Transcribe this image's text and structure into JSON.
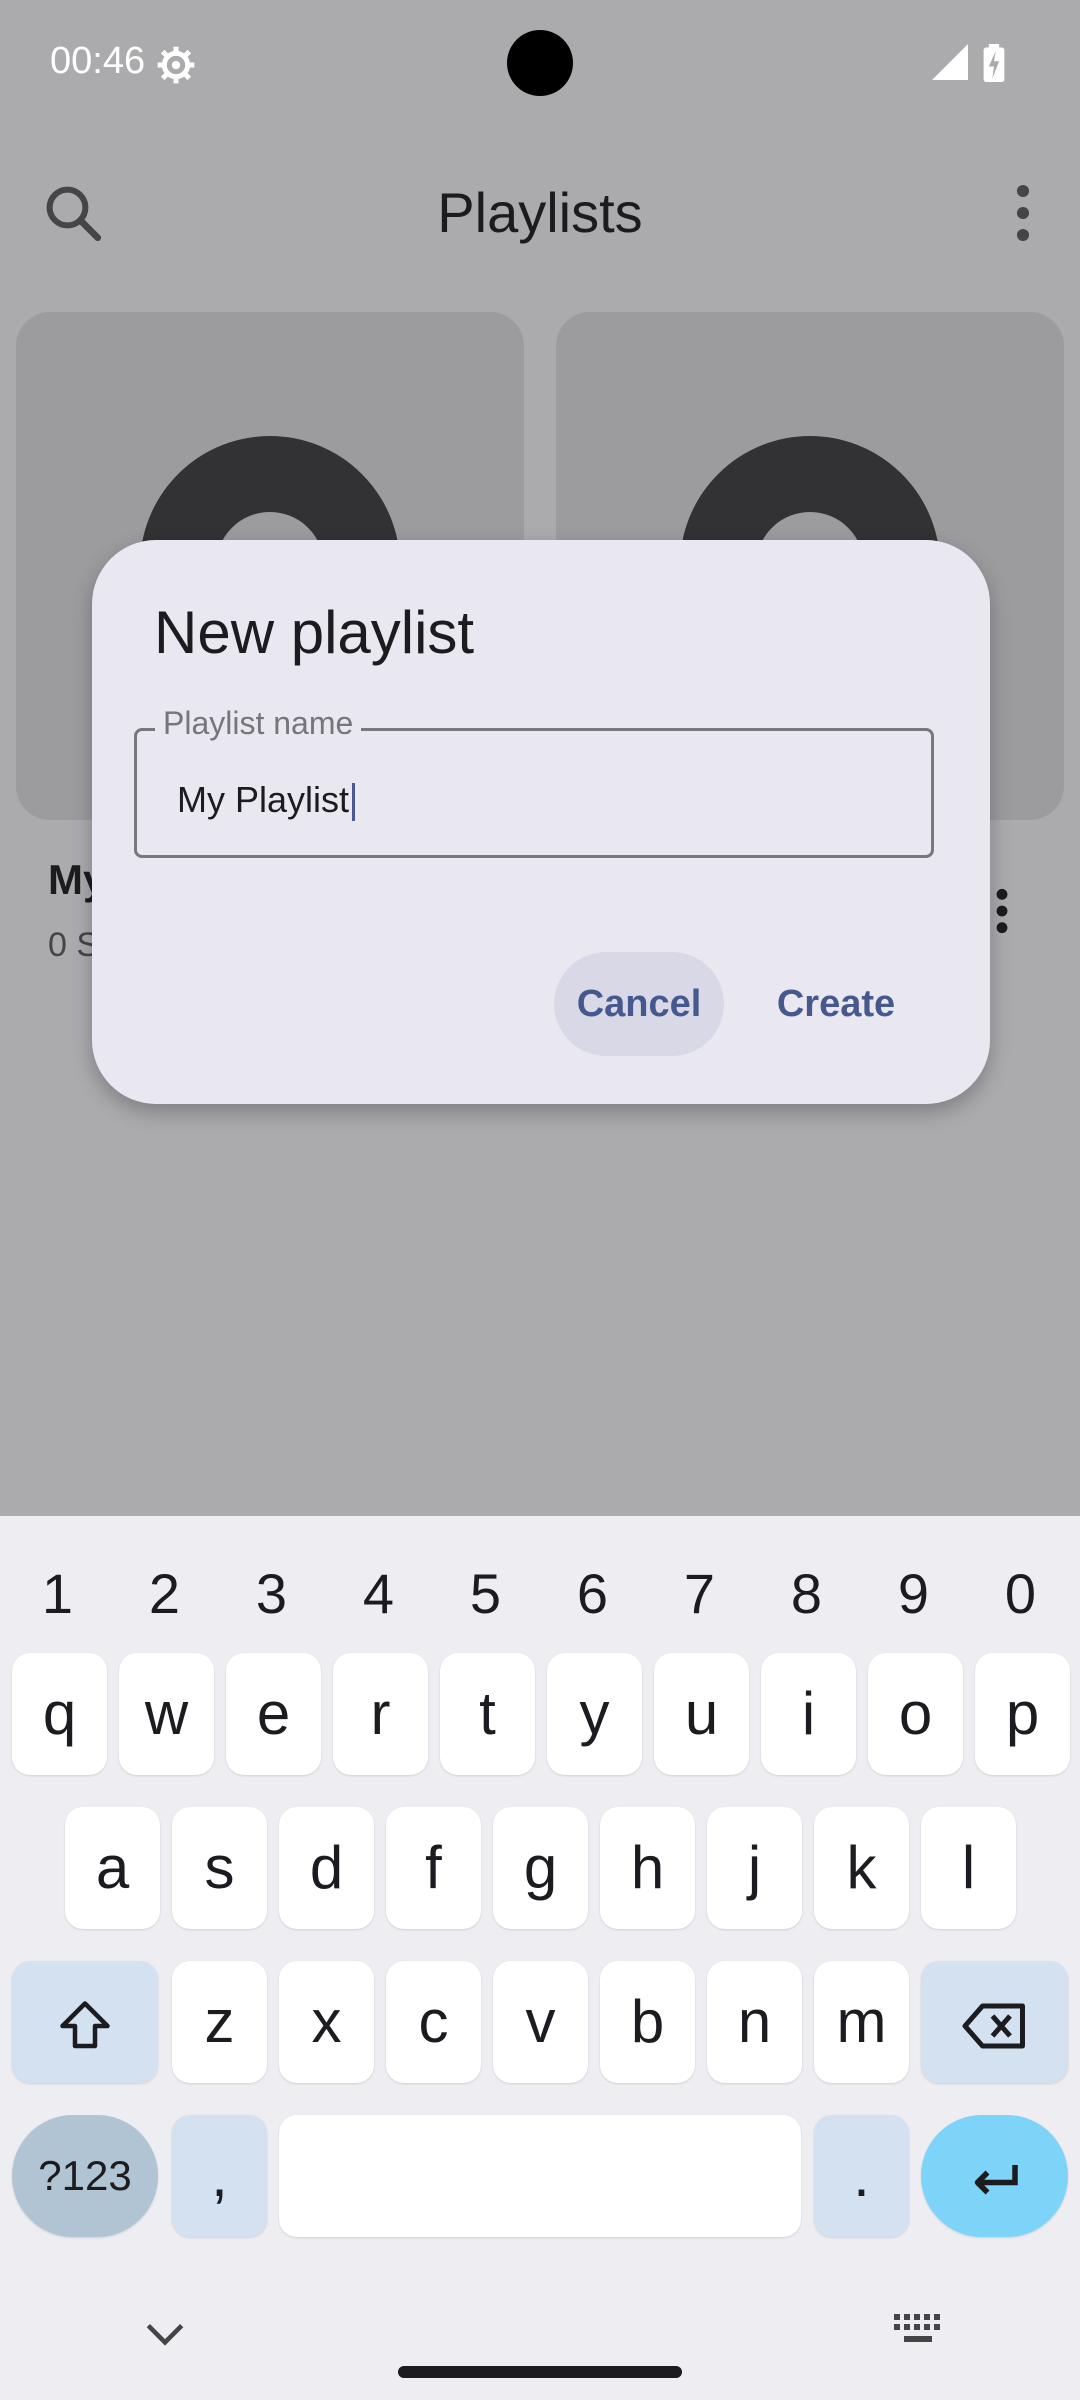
{
  "status_bar": {
    "time": "00:46"
  },
  "app_bar": {
    "title": "Playlists"
  },
  "playlist_card": {
    "title": "My Playlist",
    "subtitle": "0 Songs"
  },
  "dialog": {
    "title": "New playlist",
    "field_label": "Playlist name",
    "field_value": "My Playlist",
    "cancel_label": "Cancel",
    "create_label": "Create"
  },
  "keyboard": {
    "numbers": [
      "1",
      "2",
      "3",
      "4",
      "5",
      "6",
      "7",
      "8",
      "9",
      "0"
    ],
    "row1": [
      "q",
      "w",
      "e",
      "r",
      "t",
      "y",
      "u",
      "i",
      "o",
      "p"
    ],
    "row2": [
      "a",
      "s",
      "d",
      "f",
      "g",
      "h",
      "j",
      "k",
      "l"
    ],
    "row3": [
      "z",
      "x",
      "c",
      "v",
      "b",
      "n",
      "m"
    ],
    "symbols_label": "?123",
    "comma": ",",
    "period": "."
  }
}
